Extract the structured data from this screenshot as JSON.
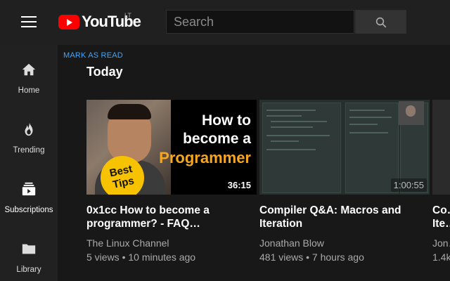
{
  "header": {
    "logo_text": "YouTube",
    "logo_country": "LT",
    "search_placeholder": "Search",
    "menu_icon": "hamburger-icon",
    "search_icon": "search-icon"
  },
  "sidebar": {
    "items": [
      {
        "label": "Home",
        "icon": "home-icon"
      },
      {
        "label": "Trending",
        "icon": "flame-icon"
      },
      {
        "label": "Subscriptions",
        "icon": "subscriptions-icon"
      },
      {
        "label": "Library",
        "icon": "folder-icon"
      }
    ]
  },
  "main": {
    "mark_as_read": "MARK AS READ",
    "section_title": "Today",
    "videos": [
      {
        "title": "0x1cc How to become a programmer? - FAQ…",
        "channel": "The Linux Channel",
        "meta": "5 views • 10 minutes ago",
        "duration": "36:15",
        "thumb_lines": [
          "How to",
          "become a",
          "Programmer"
        ],
        "badge": [
          "Best",
          "Tips"
        ]
      },
      {
        "title": "Compiler Q&A: Macros and Iteration",
        "channel": "Jonathan Blow",
        "meta": "481 views • 7 hours ago",
        "duration": "1:00:55"
      },
      {
        "title": "Co… Ite…",
        "channel": "Jon…",
        "meta": "1.4k…"
      }
    ]
  },
  "colors": {
    "background": "#181818",
    "topbar": "#202020",
    "sidebar": "#212121",
    "accent_blue": "#3ea6ff",
    "brand_red": "#ff0000"
  }
}
